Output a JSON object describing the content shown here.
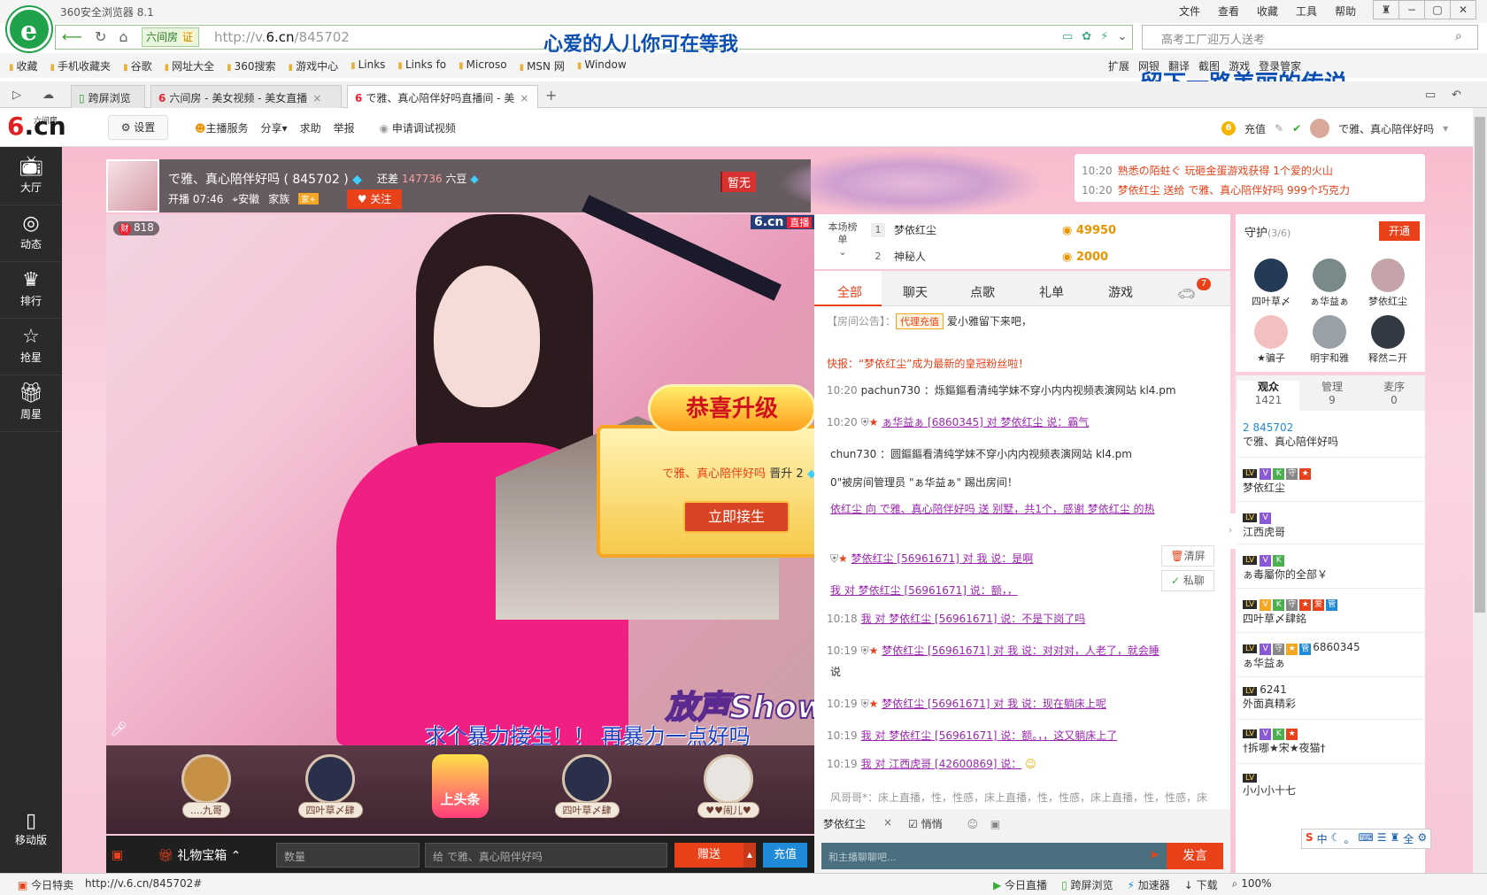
{
  "browser": {
    "title": "360安全浏览器 8.1",
    "menu": [
      "文件",
      "查看",
      "收藏",
      "工具",
      "帮助"
    ],
    "site_badge": "六间房",
    "site_badge_cert": "证",
    "url_prefix": "http://v.",
    "url_domain": "6.cn",
    "url_path": "/845702",
    "lyric_line1": "心爱的人儿你可在等我",
    "lyric_line2": "留下一路美丽的传说",
    "search_placeholder": "高考工厂迎万人送考",
    "favorites": [
      "收藏",
      "手机收藏夹",
      "谷歌",
      "网址大全",
      "360搜索",
      "游戏中心",
      "Links",
      "Links fo",
      "Microso",
      "MSN 网",
      "Window"
    ],
    "extensions": [
      "扩展",
      "网银",
      "翻译",
      "截图",
      "游戏",
      "登录管家"
    ],
    "tabs": [
      {
        "label": "跨屏浏览"
      },
      {
        "label": "六间房 - 美女视频 - 美女直播"
      },
      {
        "label": "で雅、真心陪伴好吗直播间 - 美"
      }
    ],
    "status_url": "http://v.6.cn/845702#",
    "status_left": "今日特卖",
    "status_right": [
      "今日直播",
      "跨屏浏览",
      "加速器",
      "下载",
      "100%"
    ]
  },
  "site": {
    "logo_top": "六间房",
    "logo_main": "6",
    "logo_suffix": ".cn",
    "settings": "设置",
    "nav": [
      "主播服务",
      "分享",
      "求助",
      "举报",
      "申请调试视频"
    ],
    "recharge": "充值",
    "user_name": "で雅、真心陪伴好吗"
  },
  "sidebar": [
    {
      "label": "大厅",
      "icon": "tv-icon"
    },
    {
      "label": "动态",
      "icon": "compass-icon"
    },
    {
      "label": "排行",
      "icon": "crown-icon"
    },
    {
      "label": "抢星",
      "icon": "star-icon"
    },
    {
      "label": "周星",
      "icon": "gift-icon"
    }
  ],
  "sidebar_mobile": "移动版",
  "anchor": {
    "name": "で雅、真心陪伴好吗 ( 845702 )",
    "need_prefix": "还差",
    "need_value": "147736",
    "need_suffix": "六豆",
    "start_time": "开播 07:46",
    "location": "安徽",
    "family_label": "家族",
    "family_badge": "家+",
    "follow": "关注",
    "flag": "暂无"
  },
  "news": [
    {
      "time": "10:20",
      "text": "熟悉の陌蛀ぐ 玩砸金蛋游戏获得 1个爱的火山"
    },
    {
      "time": "10:20",
      "text": "梦依红尘 送给 で雅、真心陪伴好吗 999个巧克力"
    }
  ],
  "video": {
    "watermark": "6.cn",
    "watermark_tag": "直播",
    "viewer_count": "818",
    "viewer_badge": "财",
    "levelup_title": "恭喜升级",
    "levelup_name": "で雅、真心陪伴好吗",
    "levelup_text": "晋升 2",
    "levelup_button": "立即接生",
    "show_logo": "放声Show唱",
    "subtitle": "求个暴力接生！！ 再暴力一点好吗"
  },
  "seats": [
    "....九哥",
    "四叶草〆肆",
    "上头条",
    "四叶草〆肆",
    "♥♥闹儿♥"
  ],
  "gift_bar": {
    "gift_box": "礼物宝箱",
    "qty_placeholder": "数量",
    "to_label": "给  で雅、真心陪伴好吗",
    "give": "赠送",
    "charge": "充值"
  },
  "rank": {
    "label": "本场榜单",
    "rows": [
      {
        "num": "1",
        "name": "梦依红尘",
        "value": "49950"
      },
      {
        "num": "2",
        "name": "神秘人",
        "value": "2000"
      }
    ]
  },
  "chat_tabs": [
    "全部",
    "聊天",
    "点歌",
    "礼单",
    "游戏"
  ],
  "chat_tab_badge": "7",
  "chat": {
    "notice_label": "【房间公告】：",
    "notice_badge": "代理充值",
    "notice_text": "爱小雅留下来吧，",
    "news": "快报：“梦依红尘”成为最新的皇冠粉丝啦！",
    "lines": [
      {
        "time": "10:20",
        "text": "pachun730 ：烁鏂鏂看清纯学妹不穿小内内视频表演网站 kl4.pm"
      },
      {
        "time": "10:20",
        "text": "ぁ华益ぁ [6860345] 对 梦依红尘 说：霸气"
      },
      {
        "time": "",
        "text": "chun730 ：圆鏂鏂看清纯学妹不穿小内内视频表演网站 kl4.pm"
      },
      {
        "time": "",
        "text": "0\"被房间管理员 \"ぁ华益ぁ\" 踢出房间！"
      },
      {
        "time": "",
        "text": "依红尘 向 で雅、真心陪伴好吗 送  别墅，共1个，感谢 梦依红尘 的热"
      },
      {
        "time": "",
        "text": "梦依红尘 [56961671] 对 我 说：是啊"
      },
      {
        "time": "",
        "text": "我 对 梦依红尘 [56961671] 说：额，，"
      },
      {
        "time": "10:18",
        "text": "我 对 梦依红尘 [56961671] 说：不是下岗了吗"
      },
      {
        "time": "10:19",
        "text": "梦依红尘 [56961671] 对 我 说：对对对，人老了，就会睡"
      },
      {
        "time": "",
        "text": "说"
      },
      {
        "time": "10:19",
        "text": "梦依红尘 [56961671] 对 我 说：现在躺床上呢"
      },
      {
        "time": "10:19",
        "text": "我 对 梦依红尘 [56961671] 说：额。，，这又躺床上了"
      },
      {
        "time": "10:19",
        "text": "我 对 江西虎哥 [42600869] 说："
      },
      {
        "time": "",
        "text": "风哥哥*：床上直播，性，性感，床上直播，性，性感，床上直播，性，性感，床"
      }
    ],
    "clear": "清屏",
    "private": "私聊",
    "target": "梦依红尘",
    "quiet": "悄悄",
    "input_placeholder": "和主播聊聊吧...",
    "send": "发言"
  },
  "guard": {
    "title": "守护",
    "count": "(3/6)",
    "open": "开通",
    "members": [
      "四叶草〆",
      "ぁ华益ぁ",
      "梦依红尘",
      "★骗子",
      "明宇和雅",
      "释然ニ开"
    ]
  },
  "list_tabs": [
    {
      "label": "观众",
      "count": "1421"
    },
    {
      "label": "管理",
      "count": "9"
    },
    {
      "label": "麦序",
      "count": "0"
    }
  ],
  "users": [
    {
      "line1": "2 845702",
      "line2": "で雅、真心陪伴好吗"
    },
    {
      "line1": "",
      "line2": "梦依红尘"
    },
    {
      "line1": "",
      "line2": "江西虎哥"
    },
    {
      "line1": "",
      "line2": "ぁ毒屬你的全部￥"
    },
    {
      "line1": "四叶草〆肆銘",
      "line2": ""
    },
    {
      "line1": "6860345",
      "line2": "ぁ华益ぁ"
    },
    {
      "line1": "6241",
      "line2": "外面真精彩"
    },
    {
      "line1": "",
      "line2": "†拆哪★宋★夜猫†"
    },
    {
      "line1": "",
      "line2": "小小小十七"
    }
  ],
  "sogou": [
    "S",
    "中",
    "☾",
    "。",
    "⌨",
    "☰",
    "♜",
    "全",
    "⚙"
  ]
}
